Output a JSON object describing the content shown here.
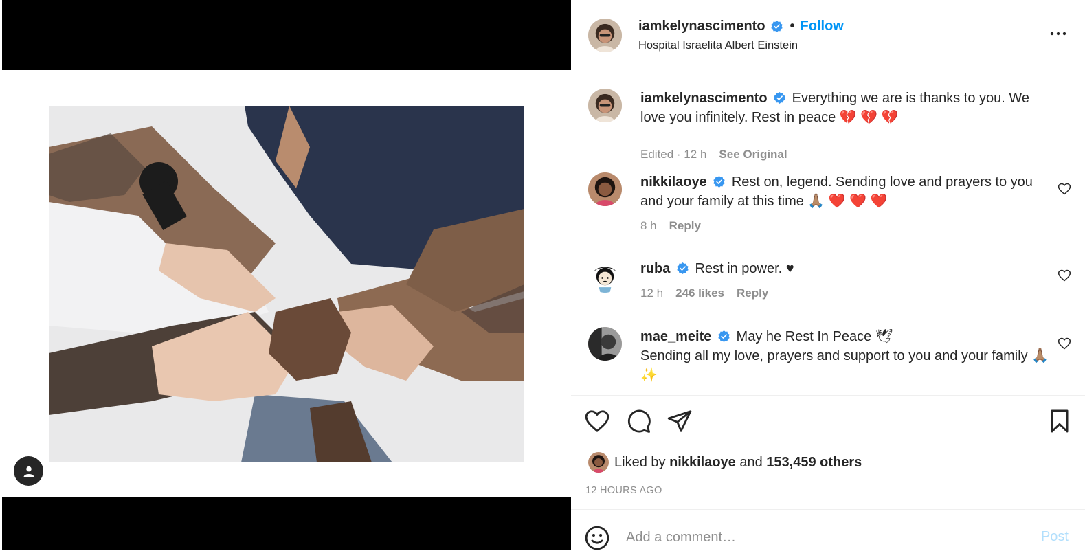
{
  "post": {
    "username": "iamkelynascimento",
    "follow_label": "Follow",
    "separator": "•",
    "location": "Hospital Israelita Albert Einstein"
  },
  "caption": {
    "username": "iamkelynascimento",
    "text": "Everything we are is thanks to you. We love you infinitely. Rest in peace 💔 💔 💔",
    "edited": "Edited · 12 h",
    "see_original": "See Original"
  },
  "comments": [
    {
      "username": "nikkilaoye",
      "text": "Rest on, legend. Sending love and prayers to you and your family at this time 🙏🏽 ❤️ ❤️ ❤️",
      "time": "8 h",
      "likes": "",
      "reply": "Reply"
    },
    {
      "username": "ruba",
      "text": "Rest in power. ♥",
      "time": "12 h",
      "likes": "246 likes",
      "reply": "Reply"
    },
    {
      "username": "mae_meite",
      "text": "May he Rest In Peace 🕊",
      "text2": "Sending all my love, prayers and support to you and your family 🙏🏽 ✨",
      "time": "",
      "likes": "",
      "reply": ""
    }
  ],
  "likes": {
    "prefix": "Liked by",
    "user": "nikkilaoye",
    "and": "and",
    "others": "153,459 others"
  },
  "timestamp": "12 HOURS AGO",
  "add_comment": {
    "placeholder": "Add a comment…",
    "post_label": "Post"
  },
  "colors": {
    "accent": "#0095f6",
    "verified": "#3897f0",
    "post_disabled": "#b2dffc",
    "muted": "#8e8e8e"
  },
  "icons": [
    "more-icon",
    "verified-icon",
    "heart-icon",
    "comment-icon",
    "share-icon",
    "bookmark-icon",
    "emoji-icon",
    "user-tag-icon"
  ]
}
